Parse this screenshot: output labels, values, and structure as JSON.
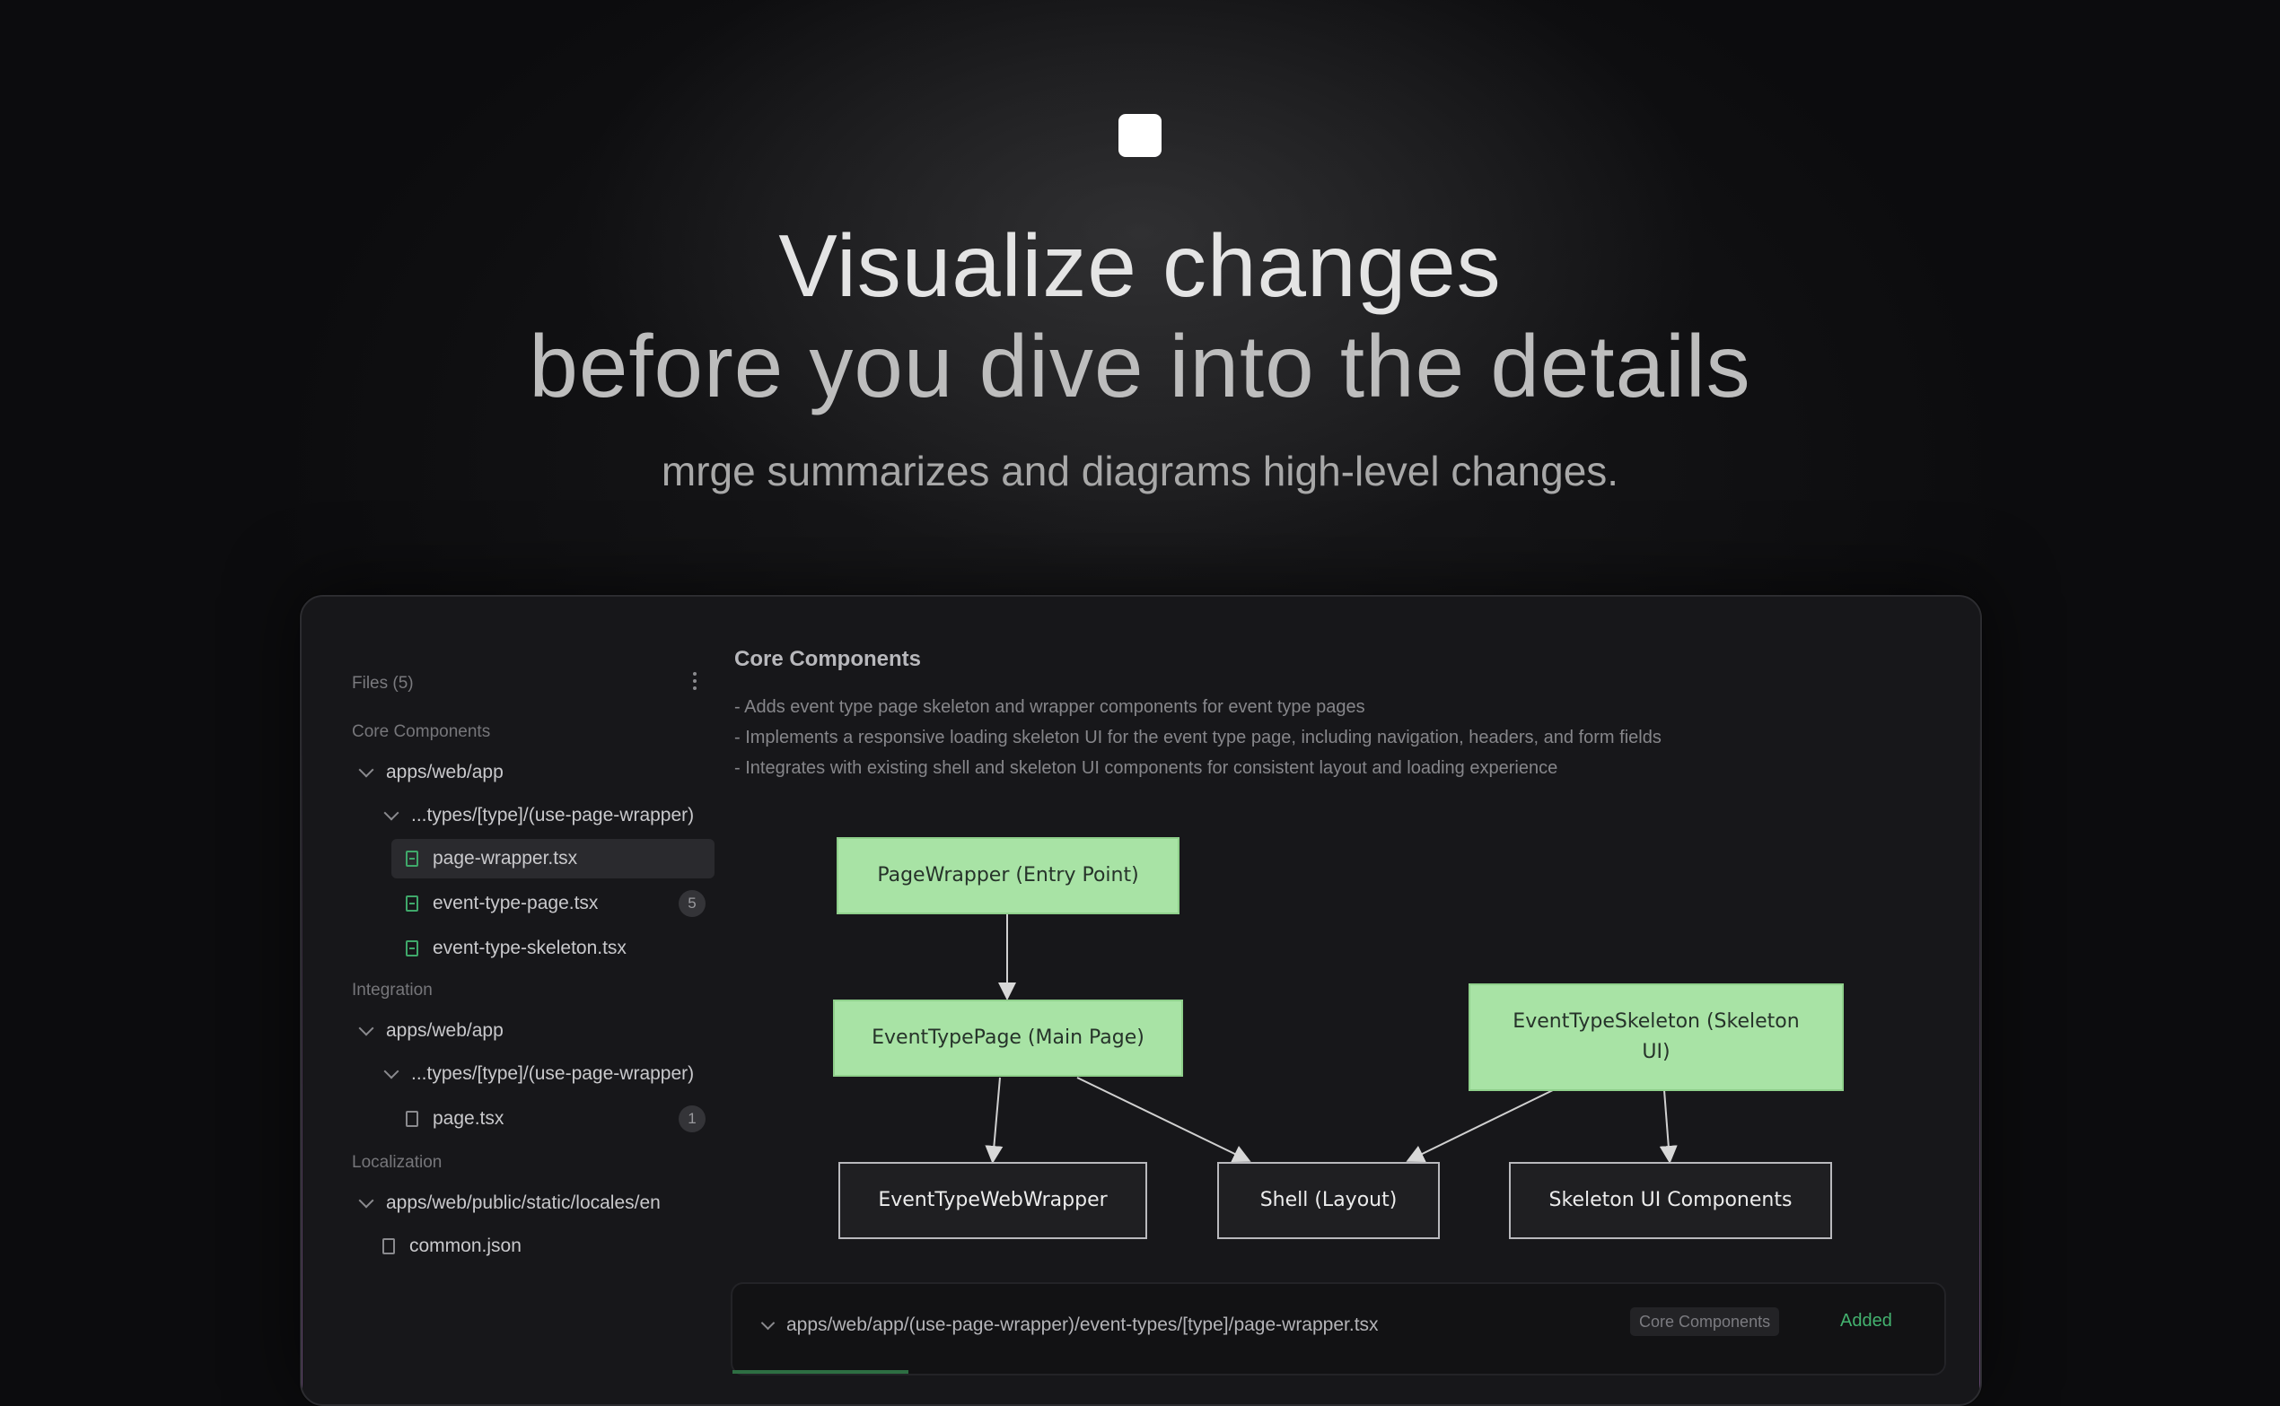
{
  "hero": {
    "title_line1": "Visualize changes",
    "title_line2": "before you dive into the details",
    "subtitle": "mrge summarizes and diagrams high-level changes."
  },
  "sidebar": {
    "files_header": "Files (5)",
    "groups": [
      {
        "label": "Core Components",
        "folder": "apps/web/app",
        "subfolder": "...types/[type]/(use-page-wrapper)",
        "files": [
          {
            "name": "page-wrapper.tsx",
            "selected": true
          },
          {
            "name": "event-type-page.tsx",
            "count": "5"
          },
          {
            "name": "event-type-skeleton.tsx"
          }
        ]
      },
      {
        "label": "Integration",
        "folder": "apps/web/app",
        "subfolder": "...types/[type]/(use-page-wrapper)",
        "files": [
          {
            "name": "page.tsx",
            "count": "1"
          }
        ]
      },
      {
        "label": "Localization",
        "folder": "apps/web/public/static/locales/en",
        "files": [
          {
            "name": "common.json"
          }
        ]
      }
    ]
  },
  "main": {
    "title": "Core Components",
    "bullets": [
      "- Adds event type page skeleton and wrapper components for event type pages",
      "- Implements a responsive loading skeleton UI for the event type page, including navigation, headers, and form fields",
      "- Integrates with existing shell and skeleton UI components for consistent layout and loading experience"
    ]
  },
  "diagram": {
    "nodes": {
      "page_wrapper": "PageWrapper (Entry Point)",
      "event_type_page": "EventTypePage (Main Page)",
      "event_type_skeleton": "EventTypeSkeleton (Skeleton UI)",
      "event_type_web_wrapper": "EventTypeWebWrapper",
      "shell": "Shell (Layout)",
      "skeleton_ui": "Skeleton UI Components"
    },
    "colors": {
      "added_fill": "#a8e3a5",
      "existing_border": "#b9b9bd"
    }
  },
  "filebar": {
    "path": "apps/web/app/(use-page-wrapper)/event-types/[type]/page-wrapper.tsx",
    "tag": "Core Components",
    "status": "Added",
    "status_color": "#43b26f"
  }
}
